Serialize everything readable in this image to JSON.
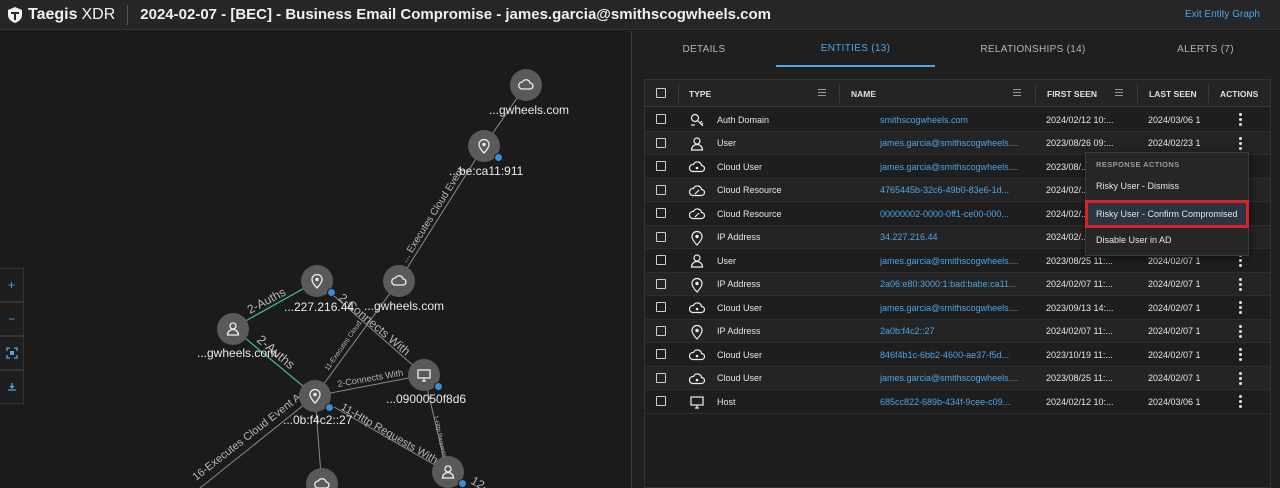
{
  "header": {
    "brand": "Taegis",
    "product": "XDR",
    "title": "2024-02-07 - [BEC] - Business Email Compromise - james.garcia@smithscogwheels.com",
    "exit_link": "Exit Entity Graph"
  },
  "graph": {
    "controls": [
      "zoom-in-icon",
      "zoom-out-icon",
      "fit-screen-icon",
      "download-icon"
    ],
    "nodes": [
      {
        "id": "n1",
        "label": "...gwheels.com",
        "icon": "cloud-icon"
      },
      {
        "id": "n2",
        "label": "...be:ca11:911",
        "icon": "location-pin-icon"
      },
      {
        "id": "n3",
        "label": "...227.216.44",
        "icon": "location-pin-icon"
      },
      {
        "id": "n4",
        "label": "...gwheels.com",
        "icon": "cloud-icon"
      },
      {
        "id": "n5",
        "label": "...gwheels.com",
        "icon": "user-icon"
      },
      {
        "id": "n6",
        "label": "...0900050f8d6",
        "icon": "monitor-icon"
      },
      {
        "id": "n7",
        "label": "...0b:f4c2::27",
        "icon": "location-pin-icon"
      },
      {
        "id": "n8",
        "label": "",
        "icon": "user-icon"
      },
      {
        "id": "n9",
        "label": "",
        "icon": "cloud-icon"
      }
    ],
    "edges": [
      {
        "label": "... Executes Cloud Event"
      },
      {
        "label": "2-Auths"
      },
      {
        "label": "2-Connects With"
      },
      {
        "label": "2-Auths"
      },
      {
        "label": "11-Executes Cloud..."
      },
      {
        "label": "2-Connects With"
      },
      {
        "label": "11-Http Requests With"
      },
      {
        "label": "16-Executes Cloud Event As"
      },
      {
        "label": "1-Http Requests With"
      },
      {
        "label": "12-..."
      }
    ]
  },
  "tabs": [
    {
      "label": "DETAILS"
    },
    {
      "label": "ENTITIES  (13)"
    },
    {
      "label": "RELATIONSHIPS  (14)"
    },
    {
      "label": "ALERTS  (7)"
    }
  ],
  "table": {
    "columns": [
      "TYPE",
      "NAME",
      "FIRST SEEN",
      "LAST SEEN",
      "ACTIONS"
    ],
    "rows": [
      {
        "icon": "auth-domain-icon",
        "type": "Auth Domain",
        "name": "smithscogwheels.com",
        "first_seen": "2024/02/12 10:...",
        "last_seen": "2024/03/06 1"
      },
      {
        "icon": "user-icon",
        "type": "User",
        "name": "james.garcia@smithscogwheels....",
        "first_seen": "2023/08/26 09:...",
        "last_seen": "2024/02/23 1"
      },
      {
        "icon": "cloud-user-icon",
        "type": "Cloud User",
        "name": "james.garcia@smithscogwheels....",
        "first_seen": "2023/08/...",
        "last_seen": ""
      },
      {
        "icon": "cloud-resource-icon",
        "type": "Cloud Resource",
        "name": "4765445b-32c6-49b0-83e6-1d...",
        "first_seen": "2024/02/...",
        "last_seen": ""
      },
      {
        "icon": "cloud-resource-icon",
        "type": "Cloud Resource",
        "name": "00000002-0000-0ff1-ce00-000...",
        "first_seen": "2024/02/...",
        "last_seen": ""
      },
      {
        "icon": "location-pin-icon",
        "type": "IP Address",
        "name": "34.227.216.44",
        "first_seen": "2024/02/...",
        "last_seen": ""
      },
      {
        "icon": "user-icon",
        "type": "User",
        "name": "james.garcia@smithscogwheels....",
        "first_seen": "2023/08/25 11:...",
        "last_seen": "2024/02/07 1"
      },
      {
        "icon": "location-pin-icon",
        "type": "IP Address",
        "name": "2a06:e80:3000:1:bad:babe:ca11...",
        "first_seen": "2024/02/07 11:...",
        "last_seen": "2024/02/07 1"
      },
      {
        "icon": "cloud-user-icon",
        "type": "Cloud User",
        "name": "james.garcia@smithscogwheels....",
        "first_seen": "2023/09/13 14:...",
        "last_seen": "2024/02/07 1"
      },
      {
        "icon": "location-pin-icon",
        "type": "IP Address",
        "name": "2a0b:f4c2::27",
        "first_seen": "2024/02/07 11:...",
        "last_seen": "2024/02/07 1"
      },
      {
        "icon": "cloud-user-icon",
        "type": "Cloud User",
        "name": "846f4b1c-6bb2-4600-ae37-f5d...",
        "first_seen": "2023/10/19 11:...",
        "last_seen": "2024/02/07 1"
      },
      {
        "icon": "cloud-user-icon",
        "type": "Cloud User",
        "name": "james.garcia@smithscogwheels....",
        "first_seen": "2023/08/25 11:...",
        "last_seen": "2024/02/07 1"
      },
      {
        "icon": "host-icon",
        "type": "Host",
        "name": "685cc822-689b-434f-9cee-c09...",
        "first_seen": "2024/02/12 10:...",
        "last_seen": "2024/03/06 1"
      }
    ]
  },
  "response_menu": {
    "heading": "RESPONSE ACTIONS",
    "items": [
      "Risky User - Dismiss",
      "Risky User - Confirm Compromised",
      "Disable User in AD"
    ],
    "highlighted_index": 1
  },
  "colors": {
    "accent": "#4ea5e6",
    "highlight_border": "#d8232a",
    "edge_green": "#3cc08a"
  }
}
